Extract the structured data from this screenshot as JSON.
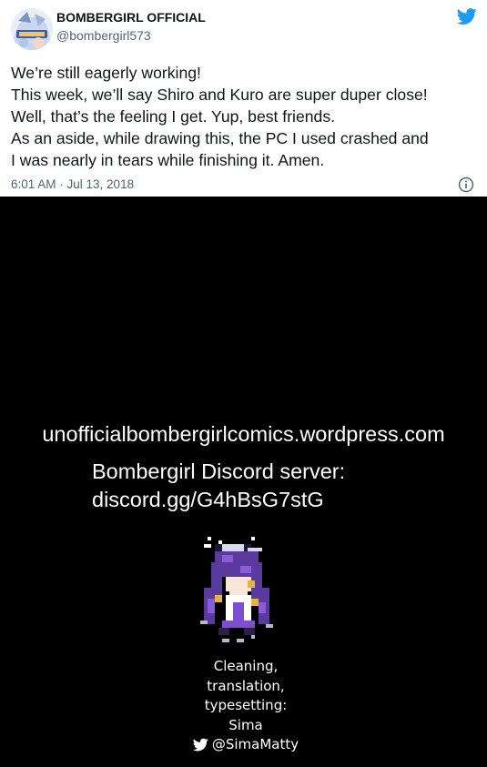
{
  "tweet": {
    "author_name": "BOMBERGIRL OFFICIAL",
    "author_handle": "@bombergirl573",
    "avatar_icon": "bombergirl-avatar-icon",
    "bird_icon": "twitter-bird-icon",
    "text_lines": [
      "We’re still eagerly working!",
      "This week, we’ll say Shiro and Kuro are super duper close!",
      "Well, that’s the feeling I get. Yup, best friends.",
      "As an aside, while drawing this, the PC I used crashed and",
      "I was nearly in tears while finishing it. Amen."
    ],
    "timestamp": "6:01 AM · Jul 13, 2018",
    "info_icon": "info-icon",
    "brand_color": "#1d9bf0"
  },
  "credits_page": {
    "site_url": "unofficialbombergirlcomics.wordpress.com",
    "discord_label": "Bombergirl Discord server:",
    "discord_link": "discord.gg/G4hBsG7stG",
    "sprite_icon": "pixel-character-sprite-icon",
    "credit_lines": [
      "Cleaning,",
      "translation,",
      "typesetting:",
      "Sima"
    ],
    "twitter_handle": "@SimaMatty"
  }
}
